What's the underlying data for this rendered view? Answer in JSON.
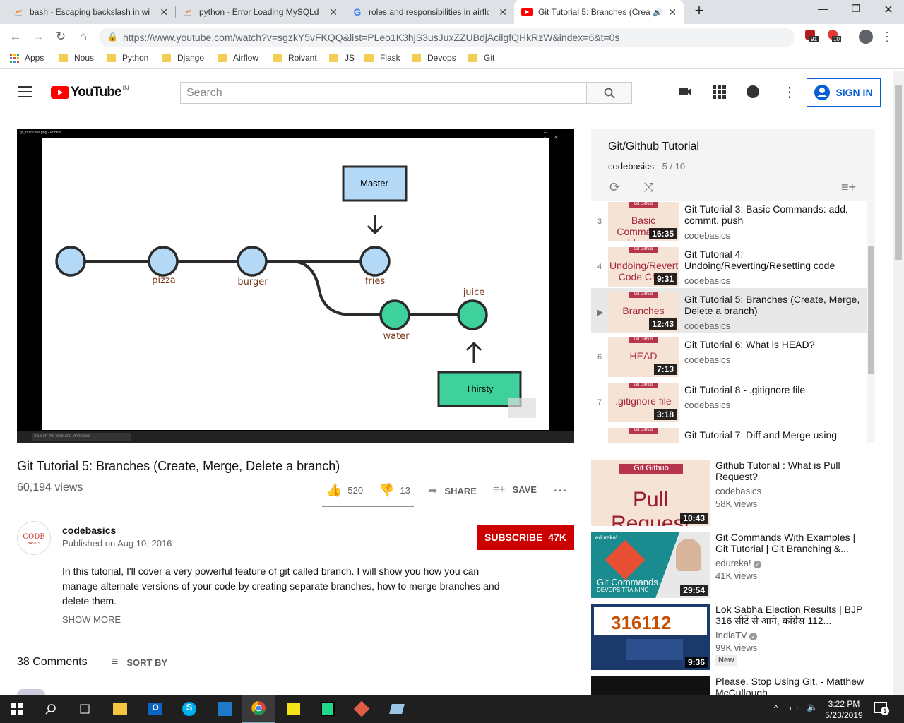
{
  "browser": {
    "tabs": [
      {
        "title": "bash - Escaping backslash in win",
        "active": false
      },
      {
        "title": "python - Error Loading MySQLdb",
        "active": false
      },
      {
        "title": "roles and responsibilities in airflo",
        "active": false
      },
      {
        "title": "Git Tutorial 5: Branches (Crea",
        "active": true
      }
    ],
    "url": "https://www.youtube.com/watch?v=sgzkY5vFKQQ&list=PLeo1K3hjS3usJuxZZUBdjAcilgfQHkRzW&index=6&t=0s",
    "ext_badges": [
      "91",
      "10"
    ],
    "bookmarks": [
      "Apps",
      "Nous",
      "Python",
      "Django",
      "Airflow",
      "Roivant",
      "JS",
      "Flask",
      "Devops",
      "Git"
    ]
  },
  "yt": {
    "logo": "YouTube",
    "region": "IN",
    "search_placeholder": "Search",
    "sign_in": "SIGN IN"
  },
  "diagram": {
    "window_title": "git_branches.png - Photos",
    "labels": [
      "pizza",
      "burger",
      "fries",
      "water",
      "juice"
    ],
    "boxes": [
      "Master",
      "Thirsty"
    ],
    "taskbar_search": "Search the web and Windows"
  },
  "video": {
    "title": "Git Tutorial 5: Branches (Create, Merge, Delete a branch)",
    "views": "60,194 views",
    "likes": "520",
    "dislikes": "13",
    "share": "SHARE",
    "save": "SAVE",
    "channel": "codebasics",
    "published": "Published on Aug 10, 2016",
    "subscribe": "SUBSCRIBE  47K",
    "description": "In this tutorial, I'll cover a very powerful feature of git called branch. I will show you how you can manage alternate versions of your code by creating separate branches, how to merge branches and delete them.",
    "show_more": "SHOW MORE",
    "comments": "38 Comments",
    "sort_by": "SORT BY"
  },
  "playlist": {
    "title": "Git/Github Tutorial",
    "channel": "codebasics",
    "position": "5 / 10",
    "items": [
      {
        "num": "3",
        "title": "Git Tutorial 3: Basic Commands: add, commit, push",
        "channel": "codebasics",
        "duration": "16:35",
        "thumb": "Basic Commands: add, comm"
      },
      {
        "num": "4",
        "title": "Git Tutorial 4: Undoing/Reverting/Resetting code",
        "channel": "codebasics",
        "duration": "9:31",
        "thumb": "Undoing/Reverting/Resetting Code Chan"
      },
      {
        "num": "▶",
        "title": "Git Tutorial 5: Branches (Create, Merge, Delete a branch)",
        "channel": "codebasics",
        "duration": "12:43",
        "thumb": "Branches"
      },
      {
        "num": "6",
        "title": "Git Tutorial 6: What is HEAD?",
        "channel": "codebasics",
        "duration": "7:13",
        "thumb": "HEAD"
      },
      {
        "num": "7",
        "title": "Git Tutorial 8 - .gitignore file",
        "channel": "codebasics",
        "duration": "3:18",
        "thumb": ".gitignore file"
      },
      {
        "num": "",
        "title": "Git Tutorial 7: Diff and Merge using",
        "channel": "",
        "duration": "",
        "thumb": ""
      }
    ],
    "thumb_tag": "Git Github"
  },
  "recommended": [
    {
      "title": "Github Tutorial : What is Pull Request?",
      "channel": "codebasics",
      "views": "58K views",
      "duration": "10:43",
      "thumb_text": "Pull Request",
      "thumb_tag": "Git Github"
    },
    {
      "title": "Git Commands With Examples | Git Tutorial | Git Branching &...",
      "channel": "edureka!",
      "views": "41K views",
      "duration": "29:54",
      "thumb_text": "Git Commands",
      "thumb_sub": "DEVOPS TRAINING",
      "thumb_brand": "edureka!"
    },
    {
      "title": "Lok Sabha Election Results | BJP 316 सीटें से आगे, कांग्रेस 112...",
      "channel": "IndiaTV",
      "views": "99K views",
      "badge": "New",
      "duration": "9:36",
      "thumb_text": "316112"
    },
    {
      "title": "Please. Stop Using Git. - Matthew McCullough",
      "channel": "",
      "views": "",
      "duration": "",
      "thumb_text": ""
    }
  ],
  "taskbar": {
    "time": "3:22 PM",
    "date": "5/23/2019",
    "notif_count": "1"
  }
}
